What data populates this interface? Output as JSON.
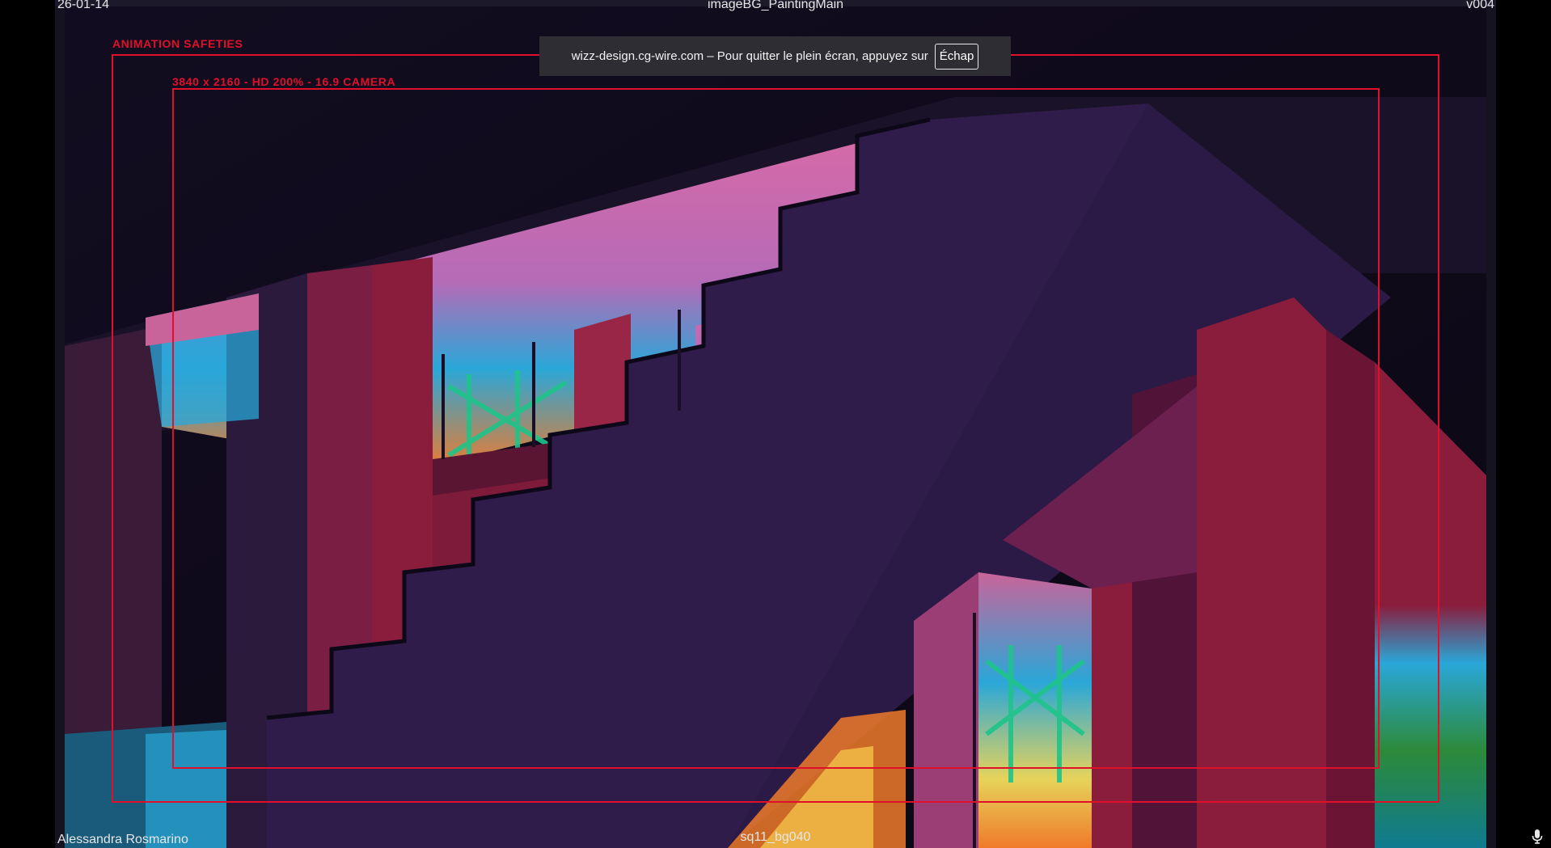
{
  "viewer": {
    "date": "26-01-14",
    "title": "imageBG_PaintingMain",
    "version": "v004",
    "artist": "Alessandra Rosmarino",
    "shot": "sq11_bg040"
  },
  "safeties": {
    "outer_label": "ANIMATION SAFETIES",
    "inner_label": "3840 x 2160 - HD 200% - 16.9 CAMERA",
    "color": "#e0102a"
  },
  "fullscreen_toast": {
    "message": "wizz-design.cg-wire.com – Pour quitter le plein écran, appuyez sur",
    "key_label": "Échap"
  },
  "icons": {
    "microphone": "microphone-icon"
  },
  "palette": {
    "background": "#000000",
    "sky_pink": "#c9649a",
    "wall_crimson": "#8a1c3c",
    "stair_purple": "#2b1a45",
    "scaffold_green": "#1ec48a",
    "sky_blue": "#2aa7d8",
    "sunset_orange": "#f07a2a"
  }
}
